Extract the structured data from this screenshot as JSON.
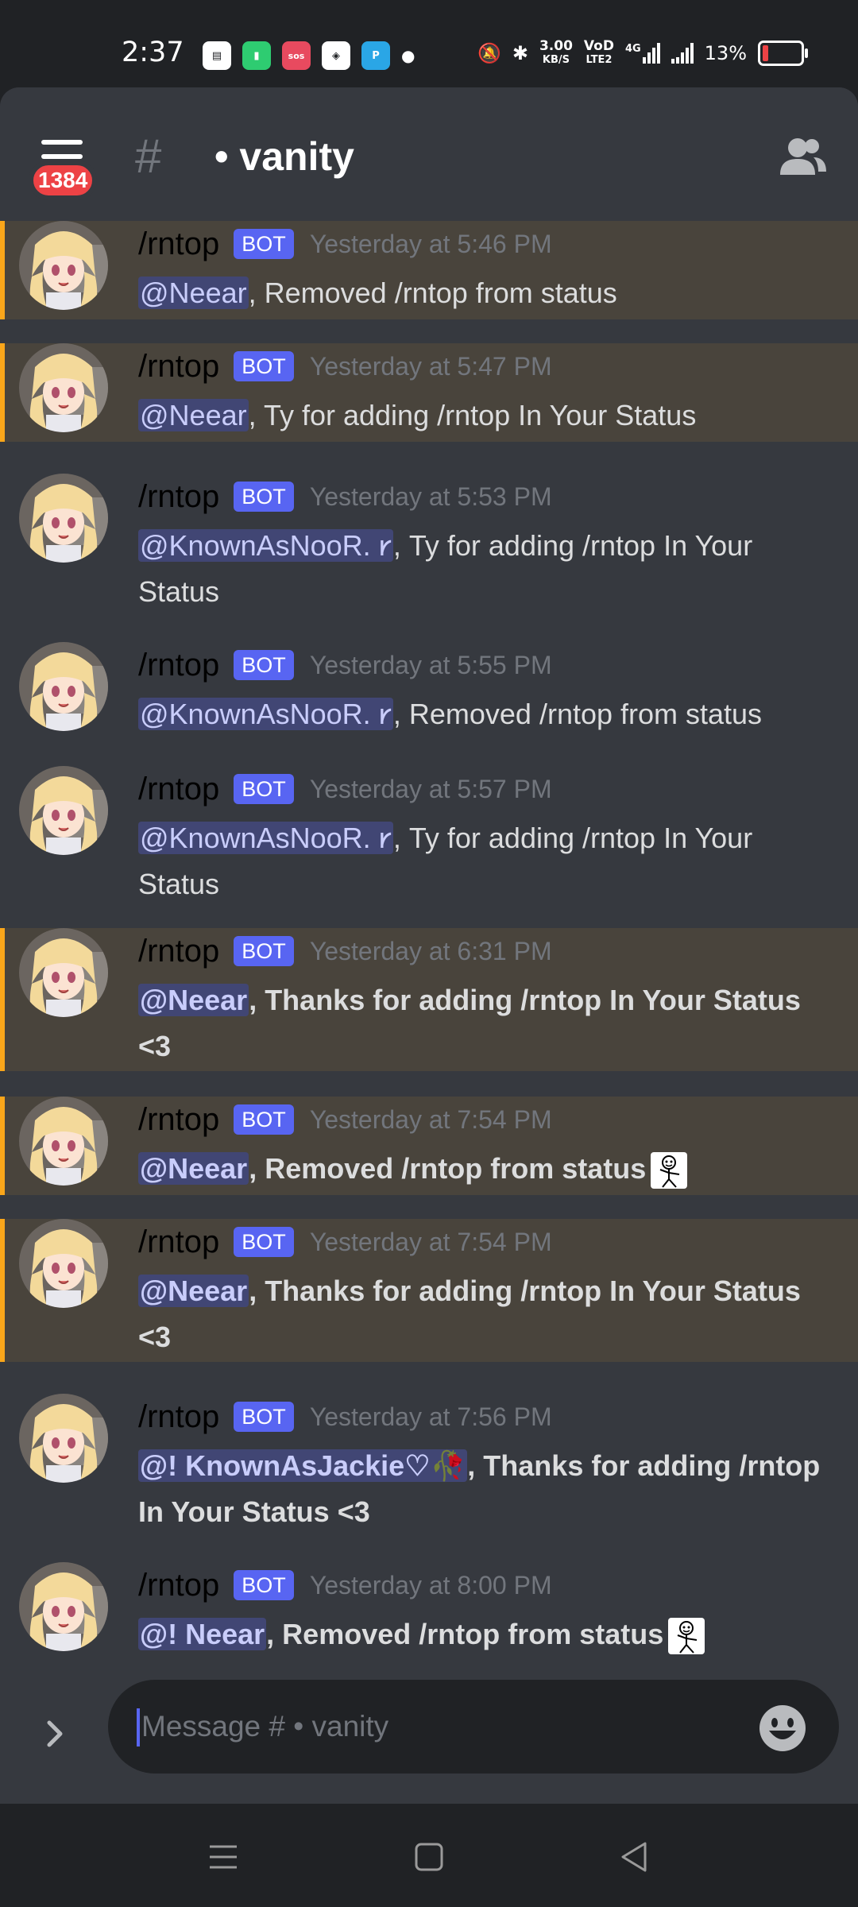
{
  "status_bar": {
    "time": "2:37",
    "net_speed_value": "3.00",
    "net_speed_unit": "KB/S",
    "volte_top": "VoD",
    "volte_bottom": "LTE2",
    "network_type": "4G",
    "battery_percent": "13%"
  },
  "header": {
    "unread_badge": "1384",
    "channel_prefix": "#",
    "channel_name": "• vanity"
  },
  "messages": [
    {
      "author": "/rntop",
      "bot_tag": "BOT",
      "timestamp": "Yesterday at 5:46 PM",
      "mention": "@Neear",
      "text": ", Removed /rntop from status",
      "highlighted": true,
      "bold": false,
      "sticker": false
    },
    {
      "author": "/rntop",
      "bot_tag": "BOT",
      "timestamp": "Yesterday at 5:47 PM",
      "mention": "@Neear",
      "text": ", Ty for adding /rntop In Your Status",
      "highlighted": true,
      "bold": false,
      "sticker": false
    },
    {
      "author": "/rntop",
      "bot_tag": "BOT",
      "timestamp": "Yesterday at 5:53 PM",
      "mention": "@KnownAsNooR. 𐑾",
      "text": ", Ty for adding /rntop In Your Status",
      "highlighted": false,
      "bold": false,
      "sticker": false
    },
    {
      "author": "/rntop",
      "bot_tag": "BOT",
      "timestamp": "Yesterday at 5:55 PM",
      "mention": "@KnownAsNooR. 𐑾",
      "text": ", Removed /rntop from status",
      "highlighted": false,
      "bold": false,
      "sticker": false
    },
    {
      "author": "/rntop",
      "bot_tag": "BOT",
      "timestamp": "Yesterday at 5:57 PM",
      "mention": "@KnownAsNooR. 𐑾",
      "text": ", Ty for adding /rntop In Your Status",
      "highlighted": false,
      "bold": false,
      "sticker": false
    },
    {
      "author": "/rntop",
      "bot_tag": "BOT",
      "timestamp": "Yesterday at 6:31 PM",
      "mention": "@Neear",
      "text": ", Thanks for adding /rntop In Your Status <3",
      "highlighted": true,
      "bold": true,
      "sticker": false
    },
    {
      "author": "/rntop",
      "bot_tag": "BOT",
      "timestamp": "Yesterday at 7:54 PM",
      "mention": "@Neear",
      "text": ", Removed /rntop from status",
      "highlighted": true,
      "bold": true,
      "sticker": true
    },
    {
      "author": "/rntop",
      "bot_tag": "BOT",
      "timestamp": "Yesterday at 7:54 PM",
      "mention": "@Neear",
      "text": ", Thanks for adding /rntop In Your Status <3",
      "highlighted": true,
      "bold": true,
      "sticker": false
    },
    {
      "author": "/rntop",
      "bot_tag": "BOT",
      "timestamp": "Yesterday at 7:56 PM",
      "mention": "@! KnownAsJackie♡🥀",
      "text": ", Thanks for adding /rntop In Your Status <3",
      "highlighted": false,
      "bold": true,
      "sticker": false
    },
    {
      "author": "/rntop",
      "bot_tag": "BOT",
      "timestamp": "Yesterday at 8:00 PM",
      "mention": "@!   Neear",
      "text": ", Removed /rntop from status",
      "highlighted": false,
      "bold": true,
      "sticker": true
    }
  ],
  "composer": {
    "placeholder": "Message # • vanity"
  },
  "colors": {
    "background": "#36393f",
    "highlight": "#49443c",
    "highlight_bar": "#faa61a",
    "bot_badge": "#5865f2",
    "mention_bg": "#414674",
    "notification_badge": "#ed4245"
  },
  "icons": {
    "menu": "hamburger-menu-icon",
    "members": "members-icon",
    "expand": "chevron-right-icon",
    "emoji": "emoji-icon",
    "nav_recents": "recents-icon",
    "nav_home": "home-icon",
    "nav_back": "back-icon"
  }
}
